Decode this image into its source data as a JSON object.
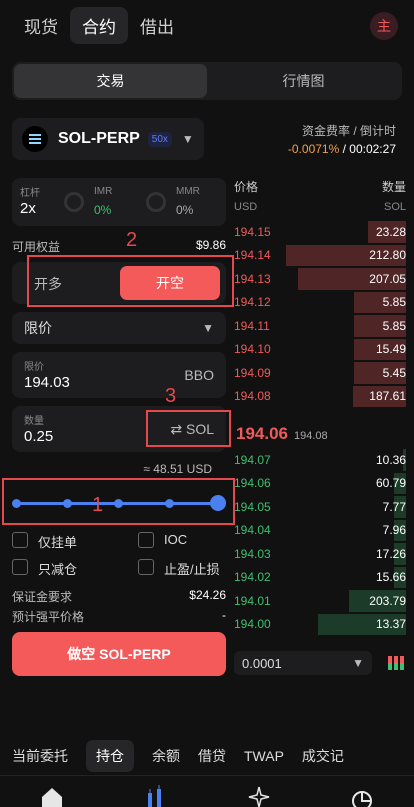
{
  "topnav": {
    "items": [
      "现货",
      "合约",
      "借出"
    ],
    "avatar": "主"
  },
  "view_tabs": [
    "交易",
    "行情图"
  ],
  "market": {
    "name": "SOL-PERP",
    "leverage_badge": "50x"
  },
  "funding": {
    "label": "资金费率 / 倒计时",
    "rate": "-0.0071%",
    "separator": " / ",
    "countdown": "00:02:27"
  },
  "leverage_card": {
    "label": "杠杆",
    "value": "2x",
    "imr_label": "IMR",
    "imr_value": "0%",
    "mmr_label": "MMR",
    "mmr_value": "0%"
  },
  "equity": {
    "label": "可用权益",
    "value": "$9.86"
  },
  "side": {
    "buy": "开多",
    "sell": "开空"
  },
  "order_type": {
    "value": "限价"
  },
  "limit_price": {
    "label": "限价",
    "value": "194.03",
    "bbo": "BBO"
  },
  "quantity": {
    "label": "数量",
    "value": "0.25",
    "unit": "SOL",
    "approx": "≈ 48.51 USD"
  },
  "slider": {
    "level_percent": 100
  },
  "checkboxes": {
    "post_only": "仅挂单",
    "ioc": "IOC",
    "reduce_only": "只减仓",
    "tp_sl": "止盈/止损"
  },
  "margin": {
    "label": "保证金要求",
    "value": "$24.26"
  },
  "liq": {
    "label": "预计强平价格",
    "value": "-"
  },
  "submit": {
    "label": "做空 SOL-PERP"
  },
  "orderbook": {
    "price_header": "价格",
    "size_header": "数量",
    "price_unit": "USD",
    "size_unit": "SOL",
    "asks": [
      {
        "price": "194.15",
        "size": "23.28",
        "depth": 0.22
      },
      {
        "price": "194.14",
        "size": "212.80",
        "depth": 0.7
      },
      {
        "price": "194.13",
        "size": "207.05",
        "depth": 0.63
      },
      {
        "price": "194.12",
        "size": "5.85",
        "depth": 0.3
      },
      {
        "price": "194.11",
        "size": "5.85",
        "depth": 0.3
      },
      {
        "price": "194.10",
        "size": "15.49",
        "depth": 0.3
      },
      {
        "price": "194.09",
        "size": "5.45",
        "depth": 0.3
      },
      {
        "price": "194.08",
        "size": "187.61",
        "depth": 0.31
      }
    ],
    "mid_price": "194.06",
    "mid_secondary": "194.08",
    "bids": [
      {
        "price": "194.07",
        "size": "10.36",
        "depth": 0.02
      },
      {
        "price": "194.06",
        "size": "60.79",
        "depth": 0.07
      },
      {
        "price": "194.05",
        "size": "7.77",
        "depth": 0.07
      },
      {
        "price": "194.04",
        "size": "7.96",
        "depth": 0.07
      },
      {
        "price": "194.03",
        "size": "17.26",
        "depth": 0.07
      },
      {
        "price": "194.02",
        "size": "15.66",
        "depth": 0.07
      },
      {
        "price": "194.01",
        "size": "203.79",
        "depth": 0.33
      },
      {
        "price": "194.00",
        "size": "13.37",
        "depth": 0.51
      }
    ],
    "tick_size": "0.0001"
  },
  "bottom_tabs": [
    "当前委托",
    "持仓",
    "余额",
    "借贷",
    "TWAP",
    "成交记"
  ],
  "annotations": [
    "1",
    "2",
    "3"
  ],
  "colors": {
    "sell": "#f55a5a",
    "buy": "#3fbf6f",
    "accent": "#4a80f0",
    "annotation": "#e5484d"
  }
}
